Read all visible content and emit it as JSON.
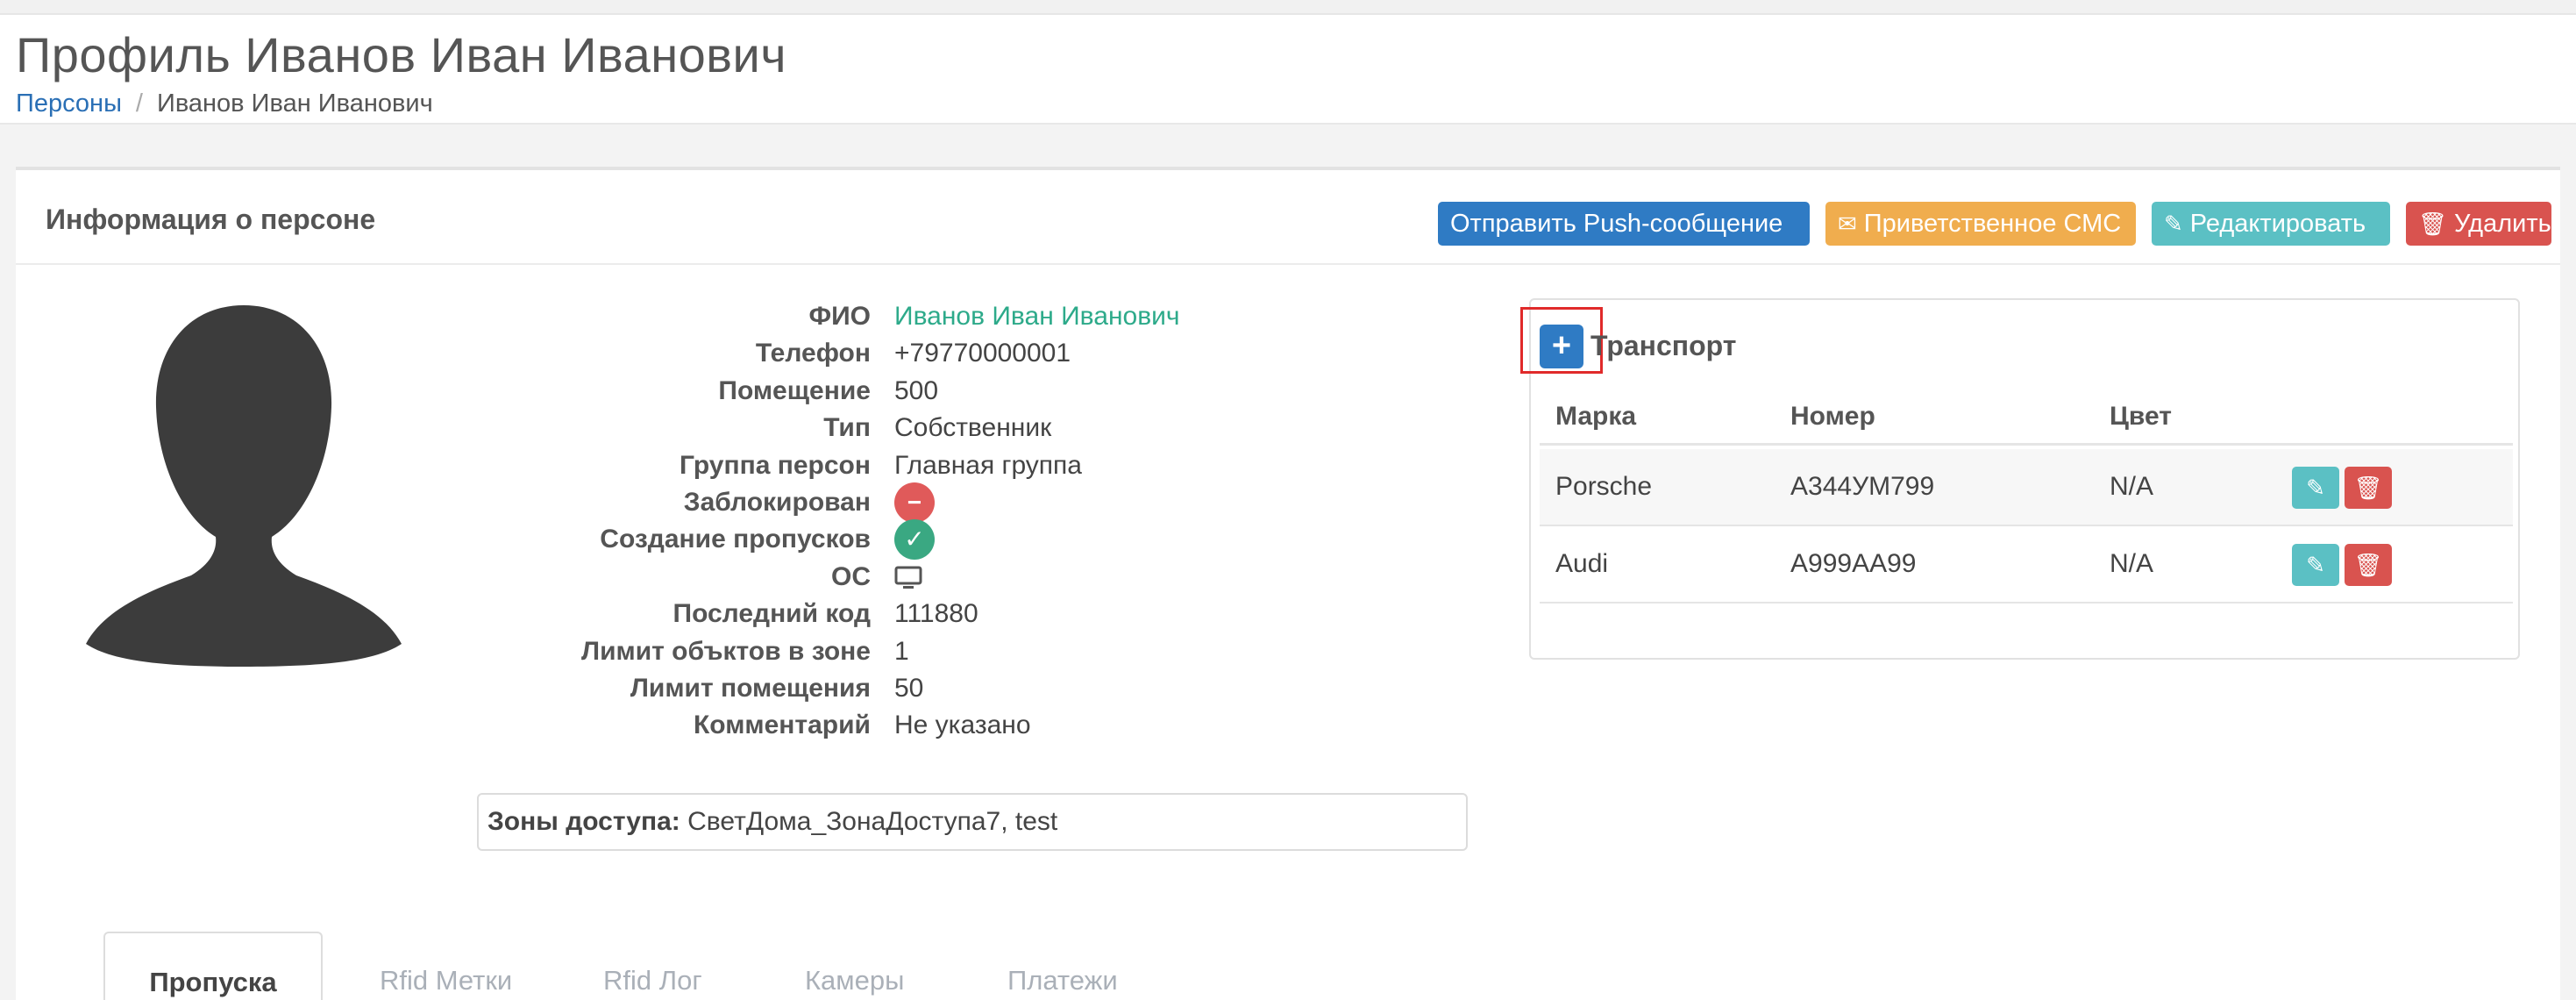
{
  "page": {
    "title": "Профиль Иванов Иван Иванович",
    "breadcrumb": {
      "link": "Персоны",
      "current": "Иванов Иван Иванович"
    }
  },
  "panel": {
    "title": "Информация о персоне",
    "actions": {
      "push": "Отправить Push-сообщение",
      "sms": "Приветственное СМС",
      "edit": "Редактировать",
      "delete": "Удалить"
    }
  },
  "person": {
    "fields": [
      {
        "label": "ФИО",
        "value": "Иванов Иван Иванович"
      },
      {
        "label": "Телефон",
        "value": "+79770000001"
      },
      {
        "label": "Помещение",
        "value": "500"
      },
      {
        "label": "Тип",
        "value": "Собственник"
      },
      {
        "label": "Группа персон",
        "value": "Главная группа"
      },
      {
        "label": "Заблокирован",
        "value": ""
      },
      {
        "label": "Создание пропусков",
        "value": ""
      },
      {
        "label": "ОС",
        "value": ""
      },
      {
        "label": "Последний код",
        "value": "111880"
      },
      {
        "label": "Лимит объктов в зоне",
        "value": "1"
      },
      {
        "label": "Лимит помещения",
        "value": "50"
      },
      {
        "label": "Комментарий",
        "value": "Не указано"
      }
    ],
    "blocked_icon": "minus-circle-icon",
    "passes_icon": "check-circle-icon",
    "os_icon": "desktop-icon"
  },
  "zones": {
    "label": "Зоны доступа:",
    "value": "СветДома_ЗонаДоступа7, test"
  },
  "transport": {
    "title": "Транспорт",
    "columns": [
      "Марка",
      "Номер",
      "Цвет"
    ],
    "rows": [
      {
        "brand": "Porsche",
        "number": "А344УМ799",
        "color": "N/A"
      },
      {
        "brand": "Audi",
        "number": "А999АА99",
        "color": "N/A"
      }
    ]
  },
  "tabs": [
    "Пропуска",
    "Rfid Метки",
    "Rfid Лог",
    "Камеры",
    "Платежи"
  ],
  "colors": {
    "primary": "#2f7bc4",
    "warning": "#f0ad4e",
    "info": "#5bc0c4",
    "danger": "#d9534f",
    "success": "#3aa882",
    "highlight": "#e02a2a"
  }
}
